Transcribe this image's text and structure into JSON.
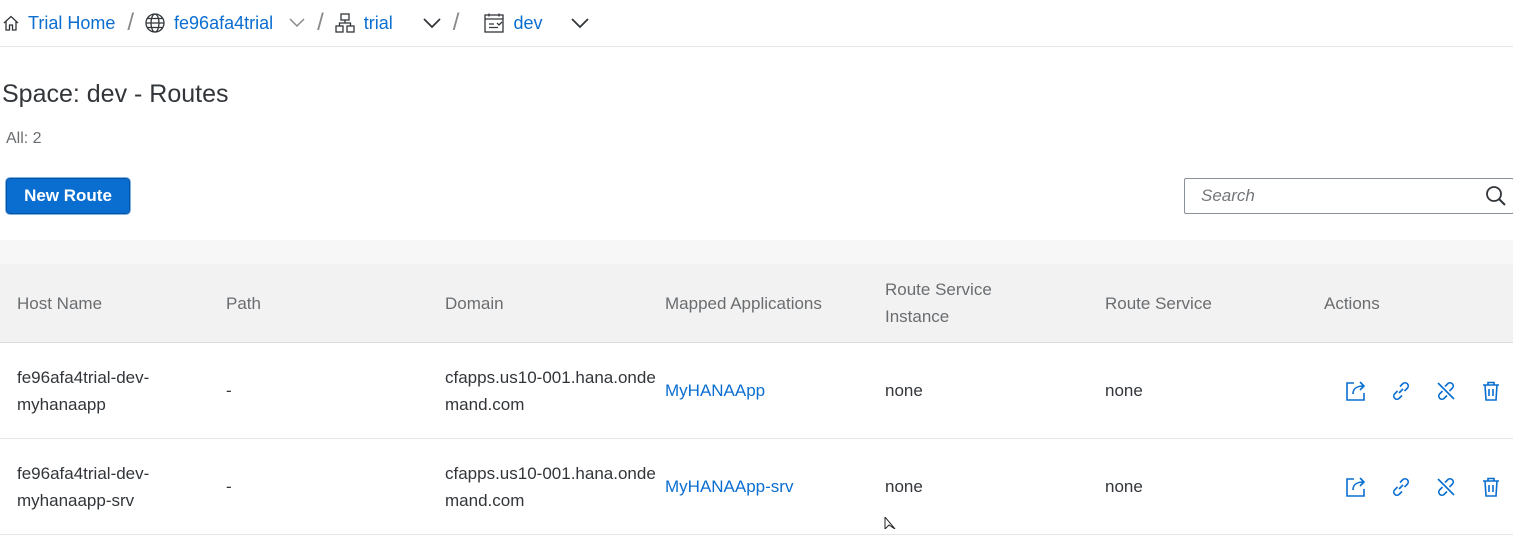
{
  "breadcrumb": {
    "home": {
      "label": "Trial Home",
      "icon": "home-icon"
    },
    "subaccount": {
      "label": "fe96afa4trial",
      "icon": "globe-icon"
    },
    "org": {
      "label": "trial",
      "icon": "hierarchy-icon"
    },
    "space": {
      "label": "dev",
      "icon": "space-icon"
    }
  },
  "page": {
    "title": "Space: dev - Routes",
    "count": "All: 2"
  },
  "toolbar": {
    "new_route_label": "New Route",
    "search_placeholder": "Search"
  },
  "table": {
    "columns": {
      "host_name": "Host Name",
      "path": "Path",
      "domain": "Domain",
      "mapped_applications": "Mapped Applications",
      "route_service_instance": "Route Service Instance",
      "route_service": "Route Service",
      "actions": "Actions"
    },
    "rows": [
      {
        "host_name": "fe96afa4trial-dev-myhanaapp",
        "path": "-",
        "domain": "cfapps.us10-001.hana.ondemand.com",
        "mapped_application": "MyHANAApp",
        "route_service_instance": "none",
        "route_service": "none"
      },
      {
        "host_name": "fe96afa4trial-dev-myhanaapp-srv",
        "path": "-",
        "domain": "cfapps.us10-001.hana.ondemand.com",
        "mapped_application": "MyHANAApp-srv",
        "route_service_instance": "none",
        "route_service": "none"
      }
    ]
  },
  "colors": {
    "accent": "#0a6ed1",
    "header_bg": "#f2f2f2",
    "text": "#32363a",
    "muted": "#6a6d70"
  }
}
